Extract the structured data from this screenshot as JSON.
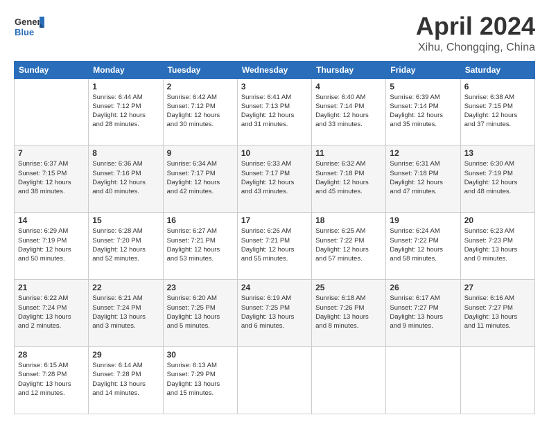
{
  "header": {
    "logo_line1": "General",
    "logo_line2": "Blue",
    "title": "April 2024",
    "subtitle": "Xihu, Chongqing, China"
  },
  "days_of_week": [
    "Sunday",
    "Monday",
    "Tuesday",
    "Wednesday",
    "Thursday",
    "Friday",
    "Saturday"
  ],
  "weeks": [
    [
      {
        "day": "",
        "info": ""
      },
      {
        "day": "1",
        "info": "Sunrise: 6:44 AM\nSunset: 7:12 PM\nDaylight: 12 hours\nand 28 minutes."
      },
      {
        "day": "2",
        "info": "Sunrise: 6:42 AM\nSunset: 7:12 PM\nDaylight: 12 hours\nand 30 minutes."
      },
      {
        "day": "3",
        "info": "Sunrise: 6:41 AM\nSunset: 7:13 PM\nDaylight: 12 hours\nand 31 minutes."
      },
      {
        "day": "4",
        "info": "Sunrise: 6:40 AM\nSunset: 7:14 PM\nDaylight: 12 hours\nand 33 minutes."
      },
      {
        "day": "5",
        "info": "Sunrise: 6:39 AM\nSunset: 7:14 PM\nDaylight: 12 hours\nand 35 minutes."
      },
      {
        "day": "6",
        "info": "Sunrise: 6:38 AM\nSunset: 7:15 PM\nDaylight: 12 hours\nand 37 minutes."
      }
    ],
    [
      {
        "day": "7",
        "info": "Sunrise: 6:37 AM\nSunset: 7:15 PM\nDaylight: 12 hours\nand 38 minutes."
      },
      {
        "day": "8",
        "info": "Sunrise: 6:36 AM\nSunset: 7:16 PM\nDaylight: 12 hours\nand 40 minutes."
      },
      {
        "day": "9",
        "info": "Sunrise: 6:34 AM\nSunset: 7:17 PM\nDaylight: 12 hours\nand 42 minutes."
      },
      {
        "day": "10",
        "info": "Sunrise: 6:33 AM\nSunset: 7:17 PM\nDaylight: 12 hours\nand 43 minutes."
      },
      {
        "day": "11",
        "info": "Sunrise: 6:32 AM\nSunset: 7:18 PM\nDaylight: 12 hours\nand 45 minutes."
      },
      {
        "day": "12",
        "info": "Sunrise: 6:31 AM\nSunset: 7:18 PM\nDaylight: 12 hours\nand 47 minutes."
      },
      {
        "day": "13",
        "info": "Sunrise: 6:30 AM\nSunset: 7:19 PM\nDaylight: 12 hours\nand 48 minutes."
      }
    ],
    [
      {
        "day": "14",
        "info": "Sunrise: 6:29 AM\nSunset: 7:19 PM\nDaylight: 12 hours\nand 50 minutes."
      },
      {
        "day": "15",
        "info": "Sunrise: 6:28 AM\nSunset: 7:20 PM\nDaylight: 12 hours\nand 52 minutes."
      },
      {
        "day": "16",
        "info": "Sunrise: 6:27 AM\nSunset: 7:21 PM\nDaylight: 12 hours\nand 53 minutes."
      },
      {
        "day": "17",
        "info": "Sunrise: 6:26 AM\nSunset: 7:21 PM\nDaylight: 12 hours\nand 55 minutes."
      },
      {
        "day": "18",
        "info": "Sunrise: 6:25 AM\nSunset: 7:22 PM\nDaylight: 12 hours\nand 57 minutes."
      },
      {
        "day": "19",
        "info": "Sunrise: 6:24 AM\nSunset: 7:22 PM\nDaylight: 12 hours\nand 58 minutes."
      },
      {
        "day": "20",
        "info": "Sunrise: 6:23 AM\nSunset: 7:23 PM\nDaylight: 13 hours\nand 0 minutes."
      }
    ],
    [
      {
        "day": "21",
        "info": "Sunrise: 6:22 AM\nSunset: 7:24 PM\nDaylight: 13 hours\nand 2 minutes."
      },
      {
        "day": "22",
        "info": "Sunrise: 6:21 AM\nSunset: 7:24 PM\nDaylight: 13 hours\nand 3 minutes."
      },
      {
        "day": "23",
        "info": "Sunrise: 6:20 AM\nSunset: 7:25 PM\nDaylight: 13 hours\nand 5 minutes."
      },
      {
        "day": "24",
        "info": "Sunrise: 6:19 AM\nSunset: 7:25 PM\nDaylight: 13 hours\nand 6 minutes."
      },
      {
        "day": "25",
        "info": "Sunrise: 6:18 AM\nSunset: 7:26 PM\nDaylight: 13 hours\nand 8 minutes."
      },
      {
        "day": "26",
        "info": "Sunrise: 6:17 AM\nSunset: 7:27 PM\nDaylight: 13 hours\nand 9 minutes."
      },
      {
        "day": "27",
        "info": "Sunrise: 6:16 AM\nSunset: 7:27 PM\nDaylight: 13 hours\nand 11 minutes."
      }
    ],
    [
      {
        "day": "28",
        "info": "Sunrise: 6:15 AM\nSunset: 7:28 PM\nDaylight: 13 hours\nand 12 minutes."
      },
      {
        "day": "29",
        "info": "Sunrise: 6:14 AM\nSunset: 7:28 PM\nDaylight: 13 hours\nand 14 minutes."
      },
      {
        "day": "30",
        "info": "Sunrise: 6:13 AM\nSunset: 7:29 PM\nDaylight: 13 hours\nand 15 minutes."
      },
      {
        "day": "",
        "info": ""
      },
      {
        "day": "",
        "info": ""
      },
      {
        "day": "",
        "info": ""
      },
      {
        "day": "",
        "info": ""
      }
    ]
  ]
}
